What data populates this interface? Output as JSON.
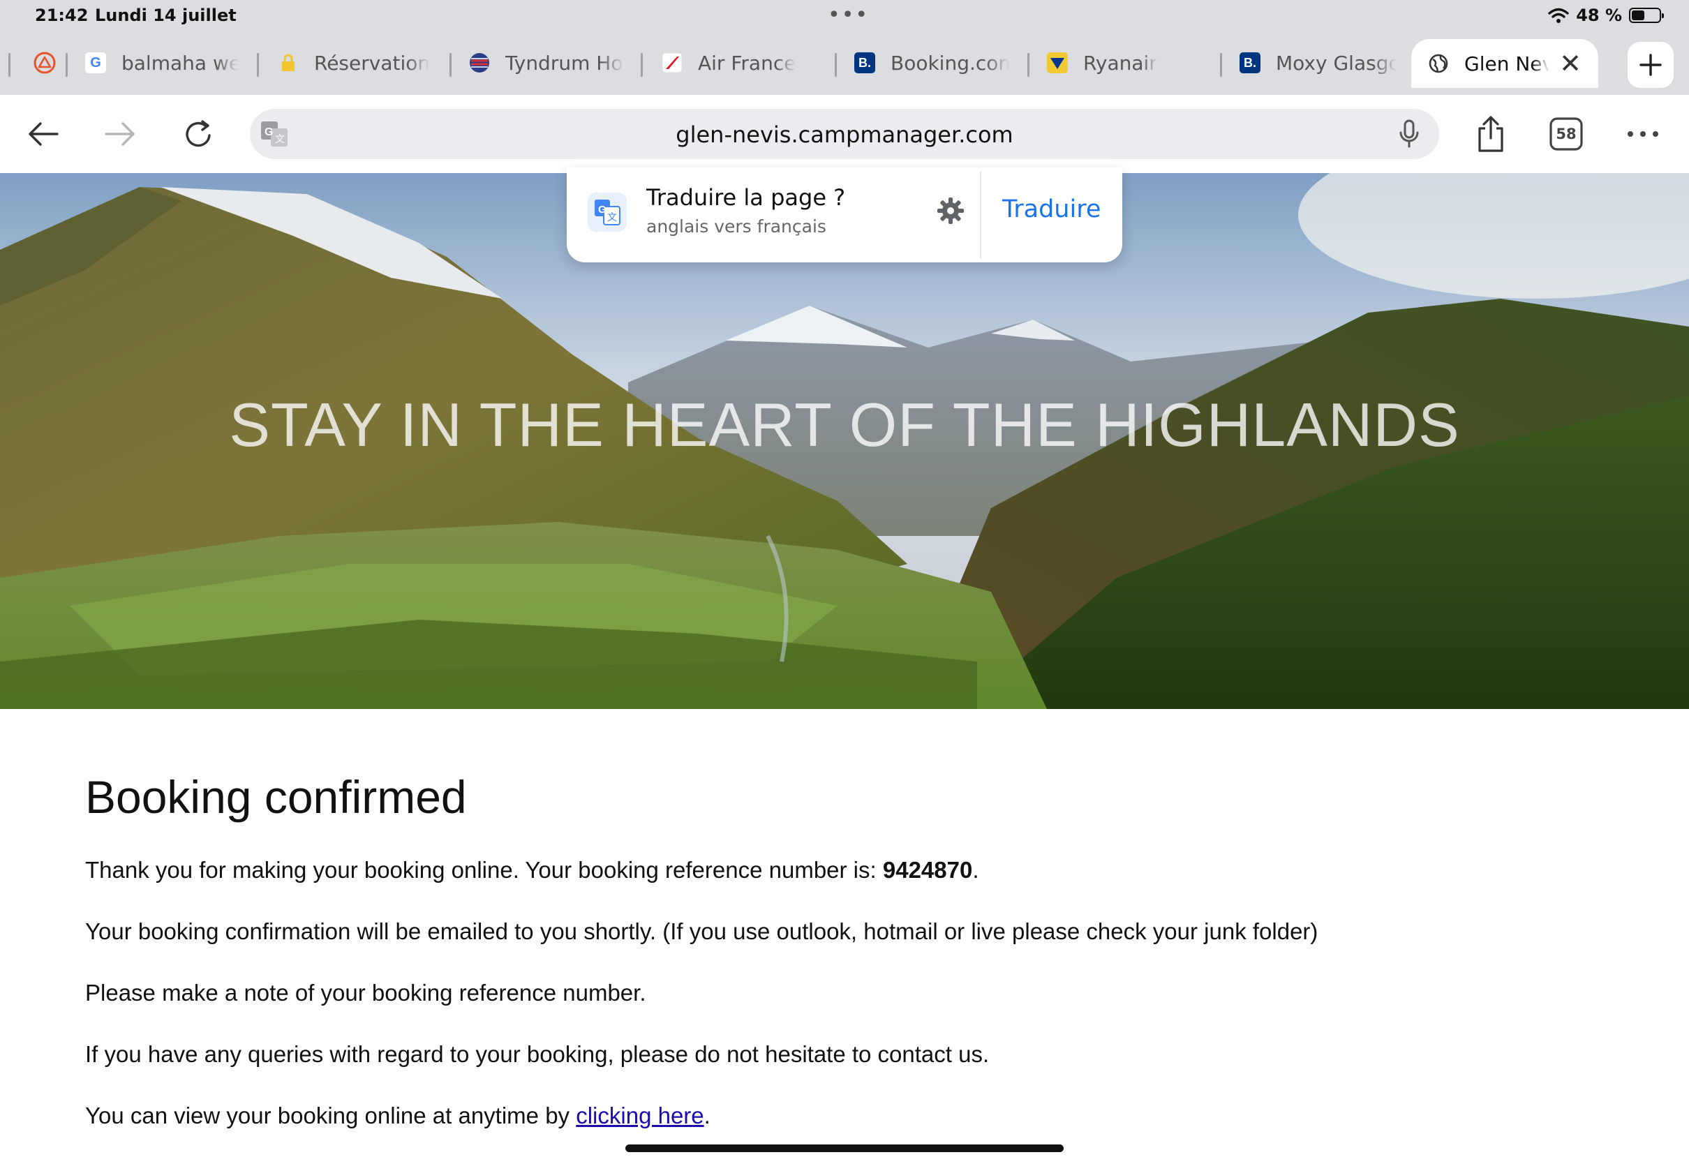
{
  "status": {
    "time": "21:42",
    "date": "Lundi 14 juillet",
    "battery_text": "48 %",
    "battery_level": 0.48
  },
  "tabs": [
    {
      "label": "balmaha we",
      "icon": "google-icon"
    },
    {
      "label": "Réservation",
      "icon": "lock-icon"
    },
    {
      "label": "Tyndrum Hol",
      "icon": "flag-icon"
    },
    {
      "label": "Air France",
      "icon": "air-france-icon"
    },
    {
      "label": "Booking.com",
      "icon": "booking-icon"
    },
    {
      "label": "Ryanair",
      "icon": "ryanair-icon"
    },
    {
      "label": "Moxy Glasgo",
      "icon": "booking-icon"
    }
  ],
  "active_tab": {
    "label": "Glen Nev",
    "icon": "globe-icon"
  },
  "toolbar": {
    "url": "glen-nevis.campmanager.com",
    "tab_count": "58"
  },
  "translate": {
    "title": "Traduire la page ?",
    "subtitle": "anglais vers français",
    "button": "Traduire"
  },
  "hero": {
    "headline": "STAY IN THE HEART OF THE HIGHLANDS"
  },
  "content": {
    "title": "Booking confirmed",
    "p1_prefix": "Thank you for making your booking online. Your booking reference number is: ",
    "reference": "9424870",
    "p1_suffix": ".",
    "p2": "Your booking confirmation will be emailed to you shortly. (If you use outlook, hotmail or live please check your junk folder)",
    "p3": "Please make a note of your booking reference number.",
    "p4": "If you have any queries with regard to your booking, please do not hesitate to contact us.",
    "p5_prefix": "You can view your booking online at anytime by ",
    "p5_link": "clicking here",
    "p5_suffix": "."
  },
  "colors": {
    "accent": "#1a73e8",
    "link": "#1a0dab",
    "chrome_bg": "#dcdde1"
  }
}
